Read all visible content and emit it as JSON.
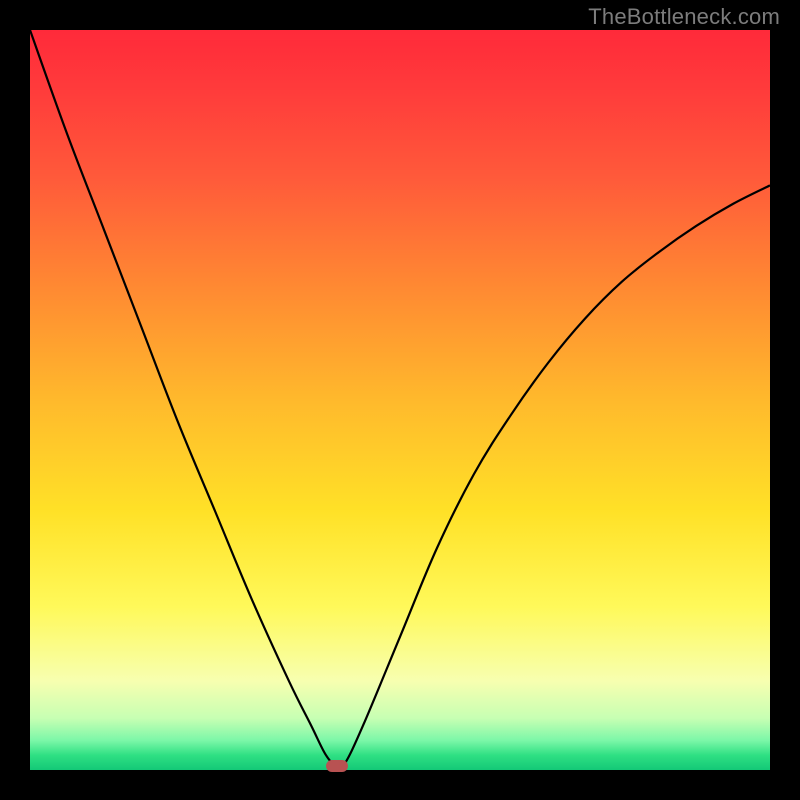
{
  "watermark": "TheBottleneck.com",
  "colors": {
    "frame": "#000000",
    "gradient_top": "#ff2a3a",
    "gradient_bottom": "#13c877",
    "curve": "#000000",
    "marker": "#b85252"
  },
  "chart_data": {
    "type": "line",
    "title": "",
    "xlabel": "",
    "ylabel": "",
    "xlim": [
      0,
      100
    ],
    "ylim": [
      0,
      100
    ],
    "notes": "Background gradient encodes bottleneck severity: red=high at top, green=low at bottom. Single V-shaped curve with cusp/minimum marked by a small rounded indicator near the bottom. No axis ticks or numeric labels shown.",
    "series": [
      {
        "name": "bottleneck-curve",
        "x": [
          0,
          5,
          10,
          15,
          20,
          25,
          30,
          35,
          38,
          40,
          41.5,
          42.5,
          45,
          50,
          55,
          60,
          65,
          70,
          75,
          80,
          85,
          90,
          95,
          100
        ],
        "y": [
          100,
          86,
          73,
          60,
          47,
          35,
          23,
          12,
          6,
          2,
          0.5,
          0.8,
          6,
          18,
          30,
          40,
          48,
          55,
          61,
          66,
          70,
          73.5,
          76.5,
          79
        ]
      }
    ],
    "marker": {
      "x": 41.5,
      "y": 0.5
    }
  }
}
